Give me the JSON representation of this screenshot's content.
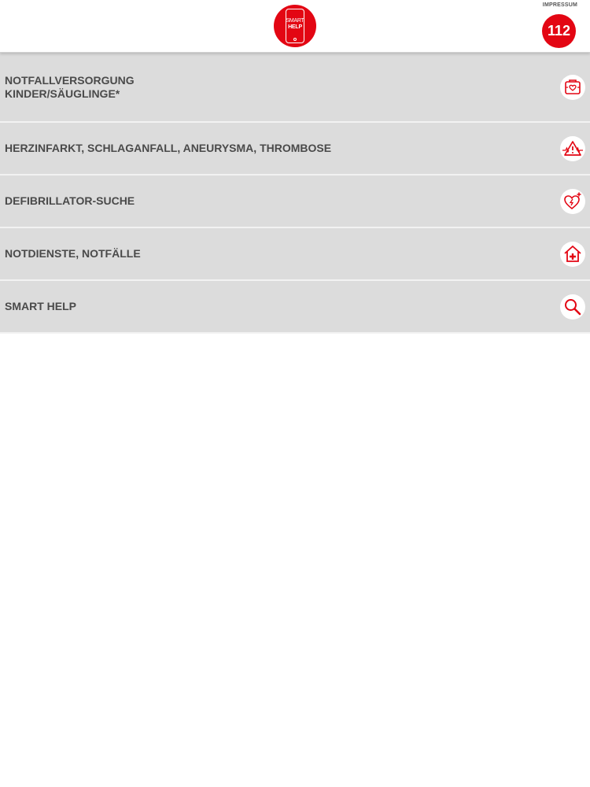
{
  "header": {
    "logo": {
      "line1": "SMART",
      "line2": "HELP"
    },
    "impressum_label": "IMPRESSUM",
    "emergency_number": "112"
  },
  "menu": {
    "items": [
      {
        "label": "NOTFALLVERSORGUNG\nKINDER/SÄUGLINGE*",
        "icon": "first-aid-kit-icon"
      },
      {
        "label": "HERZINFARKT, SCHLAGANFALL, ANEURYSMA, THROMBOSE",
        "icon": "warning-heartbeat-icon"
      },
      {
        "label": "DEFIBRILLATOR-SUCHE",
        "icon": "defibrillator-heart-icon"
      },
      {
        "label": "NOTDIENSTE, NOTFÄLLE",
        "icon": "hospital-house-icon"
      },
      {
        "label": "SMART HELP",
        "icon": "search-icon"
      }
    ]
  },
  "colors": {
    "accent": "#e30613",
    "menu_background": "#dcdcdc",
    "text": "#4a4a4a"
  }
}
